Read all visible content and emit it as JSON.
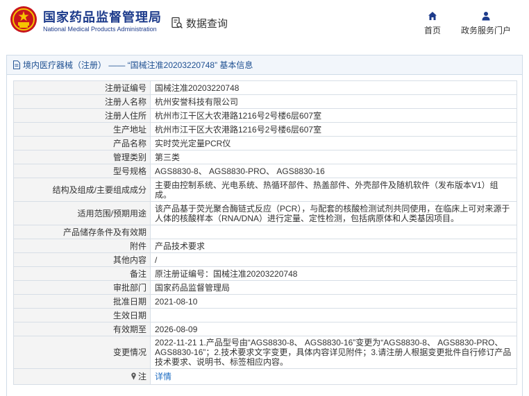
{
  "header": {
    "brand_cn": "国家药品监督管理局",
    "brand_en": "National Medical Products Administration",
    "query_label": "数据查询",
    "nav": {
      "home": "首页",
      "portal": "政务服务门户"
    },
    "brand_color": "#1d3b8b"
  },
  "panel": {
    "title": "境内医疗器械（注册） —— “国械注准20203220748” 基本信息"
  },
  "rows": [
    {
      "label": "注册证编号",
      "value": "国械注准20203220748"
    },
    {
      "label": "注册人名称",
      "value": "杭州安誉科技有限公司"
    },
    {
      "label": "注册人住所",
      "value": "杭州市江干区大农港路1216号2号楼6层607室"
    },
    {
      "label": "生产地址",
      "value": "杭州市江干区大农港路1216号2号楼6层607室"
    },
    {
      "label": "产品名称",
      "value": "实时荧光定量PCR仪"
    },
    {
      "label": "管理类别",
      "value": "第三类"
    },
    {
      "label": "型号规格",
      "value": "AGS8830-8、 AGS8830-PRO、 AGS8830-16"
    },
    {
      "label": "结构及组成/主要组成成分",
      "value": "主要由控制系统、光电系统、热循环部件、热盖部件、外壳部件及随机软件（发布版本V1）组成。"
    },
    {
      "label": "适用范围/预期用途",
      "value": "该产品基于荧光聚合酶链式反应（PCR），与配套的核酸检测试剂共同使用，在临床上可对来源于人体的核酸样本（RNA/DNA）进行定量、定性检测，包括病原体和人类基因项目。"
    },
    {
      "label": "产品储存条件及有效期",
      "value": ""
    },
    {
      "label": "附件",
      "value": "产品技术要求"
    },
    {
      "label": "其他内容",
      "value": "/"
    },
    {
      "label": "备注",
      "value": "原注册证编号：国械注准20203220748"
    },
    {
      "label": "审批部门",
      "value": "国家药品监督管理局"
    },
    {
      "label": "批准日期",
      "value": "2021-08-10"
    },
    {
      "label": "生效日期",
      "value": ""
    },
    {
      "label": "有效期至",
      "value": "2026-08-09"
    },
    {
      "label": "变更情况",
      "value": "2022-11-21 1.产品型号由“AGS8830-8、 AGS8830-16”变更为“AGS8830-8、 AGS8830-PRO、 AGS8830-16”；2.技术要求文字变更，具体内容详见附件；3.请注册人根据变更批件自行修订产品技术要求、说明书、标签相应内容。"
    }
  ],
  "note": {
    "label": "注",
    "link": "详情"
  }
}
